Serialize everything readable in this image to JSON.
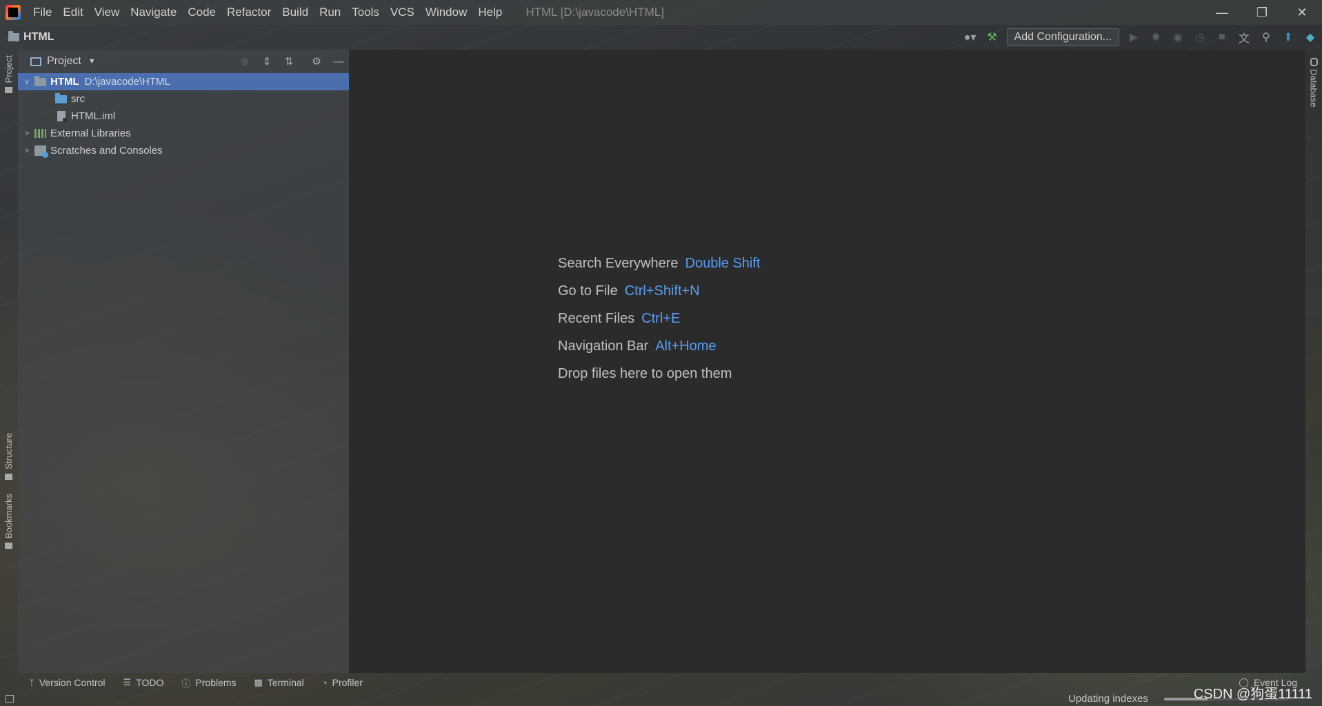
{
  "window": {
    "title": "HTML [D:\\javacode\\HTML]",
    "minimize_icon": "minimize-icon",
    "restore_icon": "restore-icon",
    "close_icon": "close-icon"
  },
  "menu": [
    "File",
    "Edit",
    "View",
    "Navigate",
    "Code",
    "Refactor",
    "Build",
    "Run",
    "Tools",
    "VCS",
    "Window",
    "Help"
  ],
  "navbar": {
    "project_name": "HTML",
    "add_configuration": "Add Configuration..."
  },
  "left_stripe": {
    "project": "Project",
    "structure": "Structure",
    "bookmarks": "Bookmarks"
  },
  "right_stripe": {
    "database": "Database"
  },
  "project_panel": {
    "title": "Project",
    "tree": [
      {
        "name": "HTML",
        "path": "D:\\javacode\\HTML",
        "expanded": true,
        "selected": true
      },
      {
        "name": "src"
      },
      {
        "name": "HTML.iml"
      },
      {
        "name": "External Libraries",
        "expanded": false
      },
      {
        "name": "Scratches and Consoles",
        "expanded": false
      }
    ]
  },
  "editor_hints": [
    {
      "label": "Search Everywhere",
      "shortcut": "Double Shift"
    },
    {
      "label": "Go to File",
      "shortcut": "Ctrl+Shift+N"
    },
    {
      "label": "Recent Files",
      "shortcut": "Ctrl+E"
    },
    {
      "label": "Navigation Bar",
      "shortcut": "Alt+Home"
    },
    {
      "label": "Drop files here to open them",
      "shortcut": ""
    }
  ],
  "bottom_tools": [
    "Version Control",
    "TODO",
    "Problems",
    "Terminal",
    "Profiler"
  ],
  "event_log": "Event Log",
  "status": {
    "updating": "Updating indexes",
    "progress": 0.35
  },
  "watermark": "CSDN @狗蛋11111",
  "colors": {
    "selection": "#4b6eaf",
    "shortcut": "#589df6",
    "editor_bg": "#2b2b2b"
  }
}
